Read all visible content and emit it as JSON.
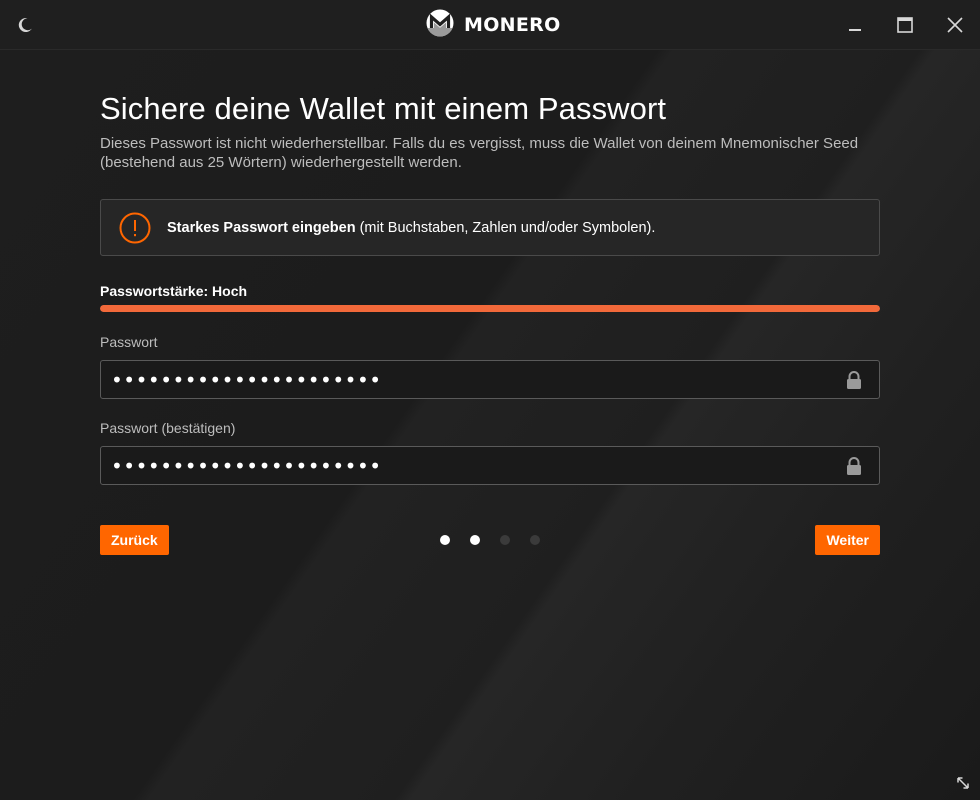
{
  "titlebar": {
    "brand": "MONERO",
    "icons": {
      "theme": "moon-icon",
      "logo": "monero-logo-icon",
      "minimize": "minimize-icon",
      "maximize": "maximize-icon",
      "close": "close-icon"
    }
  },
  "page": {
    "title": "Sichere deine Wallet mit einem Passwort",
    "description": "Dieses Passwort ist nicht wiederherstellbar. Falls du es vergisst, muss die Wallet von deinem Mnemonischer Seed (bestehend aus 25 Wörtern) wiederhergestellt werden."
  },
  "notice": {
    "strong": "Starkes Passwort eingeben",
    "rest": " (mit Buchstaben, Zahlen und/oder Symbolen).",
    "icon": "warning-circle-icon"
  },
  "strength": {
    "label": "Passwortstärke: Hoch",
    "fraction": 1.0
  },
  "fields": {
    "password": {
      "label": "Passwort",
      "value": "••••••••••••••••••••••",
      "icon": "lock-icon"
    },
    "confirm": {
      "label": "Passwort (bestätigen)",
      "value": "••••••••••••••••••••••",
      "icon": "lock-icon"
    }
  },
  "nav": {
    "back_label": "Zurück",
    "next_label": "Weiter",
    "steps_total": 4,
    "steps_active": 2
  },
  "colors": {
    "accent": "#ff6600",
    "strength_bar": "#f2693a",
    "background": "#1b1b1b"
  }
}
